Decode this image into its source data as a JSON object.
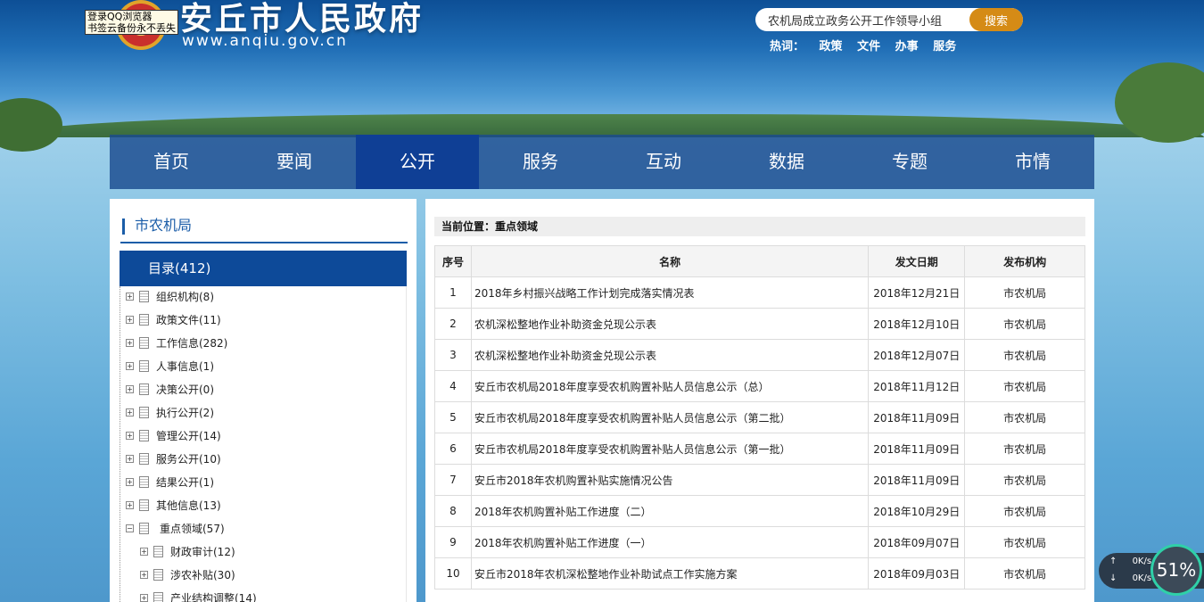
{
  "header": {
    "site_title": "安丘市人民政府",
    "site_url": "www.anqiu.gov.cn",
    "qq_tip_line1": "登录QQ浏览器",
    "qq_tip_line2": "书签云备份永不丢失"
  },
  "search": {
    "value": "农机局成立政务公开工作领导小组",
    "button": "搜索"
  },
  "hotwords": {
    "label": "热词：",
    "items": [
      "政策",
      "文件",
      "办事",
      "服务"
    ]
  },
  "nav": {
    "items": [
      "首页",
      "要闻",
      "公开",
      "服务",
      "互动",
      "数据",
      "专题",
      "市情"
    ],
    "active_index": 2
  },
  "sidebar": {
    "title": "市农机局",
    "catalog_label": "目录(412)",
    "tree": [
      {
        "label": "组织机构(8)",
        "level": 0,
        "expander": "+"
      },
      {
        "label": "政策文件(11)",
        "level": 0,
        "expander": "+"
      },
      {
        "label": "工作信息(282)",
        "level": 0,
        "expander": "+"
      },
      {
        "label": "人事信息(1)",
        "level": 0,
        "expander": "+"
      },
      {
        "label": "决策公开(0)",
        "level": 0,
        "expander": "+"
      },
      {
        "label": "执行公开(2)",
        "level": 0,
        "expander": "+"
      },
      {
        "label": "管理公开(14)",
        "level": 0,
        "expander": "+"
      },
      {
        "label": "服务公开(10)",
        "level": 0,
        "expander": "+"
      },
      {
        "label": "结果公开(1)",
        "level": 0,
        "expander": "+"
      },
      {
        "label": "其他信息(13)",
        "level": 0,
        "expander": "+"
      },
      {
        "label": "重点领域(57)",
        "level": 0,
        "expander": "−"
      },
      {
        "label": "财政审计(12)",
        "level": 1,
        "expander": "+"
      },
      {
        "label": "涉农补贴(30)",
        "level": 1,
        "expander": "+"
      },
      {
        "label": "产业结构调整(14)",
        "level": 1,
        "expander": "+"
      }
    ]
  },
  "content": {
    "breadcrumb": "当前位置：重点领域",
    "columns": [
      "序号",
      "名称",
      "发文日期",
      "发布机构"
    ],
    "rows": [
      {
        "no": "1",
        "name": "2018年乡村振兴战略工作计划完成落实情况表",
        "date": "2018年12月21日",
        "org": "市农机局"
      },
      {
        "no": "2",
        "name": "农机深松整地作业补助资金兑现公示表",
        "date": "2018年12月10日",
        "org": "市农机局"
      },
      {
        "no": "3",
        "name": "农机深松整地作业补助资金兑现公示表",
        "date": "2018年12月07日",
        "org": "市农机局"
      },
      {
        "no": "4",
        "name": "安丘市农机局2018年度享受农机购置补贴人员信息公示（总）",
        "date": "2018年11月12日",
        "org": "市农机局"
      },
      {
        "no": "5",
        "name": "安丘市农机局2018年度享受农机购置补贴人员信息公示（第二批）",
        "date": "2018年11月09日",
        "org": "市农机局"
      },
      {
        "no": "6",
        "name": "安丘市农机局2018年度享受农机购置补贴人员信息公示（第一批）",
        "date": "2018年11月09日",
        "org": "市农机局"
      },
      {
        "no": "7",
        "name": "安丘市2018年农机购置补贴实施情况公告",
        "date": "2018年11月09日",
        "org": "市农机局"
      },
      {
        "no": "8",
        "name": "2018年农机购置补贴工作进度（二）",
        "date": "2018年10月29日",
        "org": "市农机局"
      },
      {
        "no": "9",
        "name": "2018年农机购置补贴工作进度（一）",
        "date": "2018年09月07日",
        "org": "市农机局"
      },
      {
        "no": "10",
        "name": "安丘市2018年农机深松整地作业补助试点工作实施方案",
        "date": "2018年09月03日",
        "org": "市农机局"
      }
    ]
  },
  "speed_widget": {
    "up": "0K/s",
    "down": "0K/s",
    "percent": "51%"
  }
}
